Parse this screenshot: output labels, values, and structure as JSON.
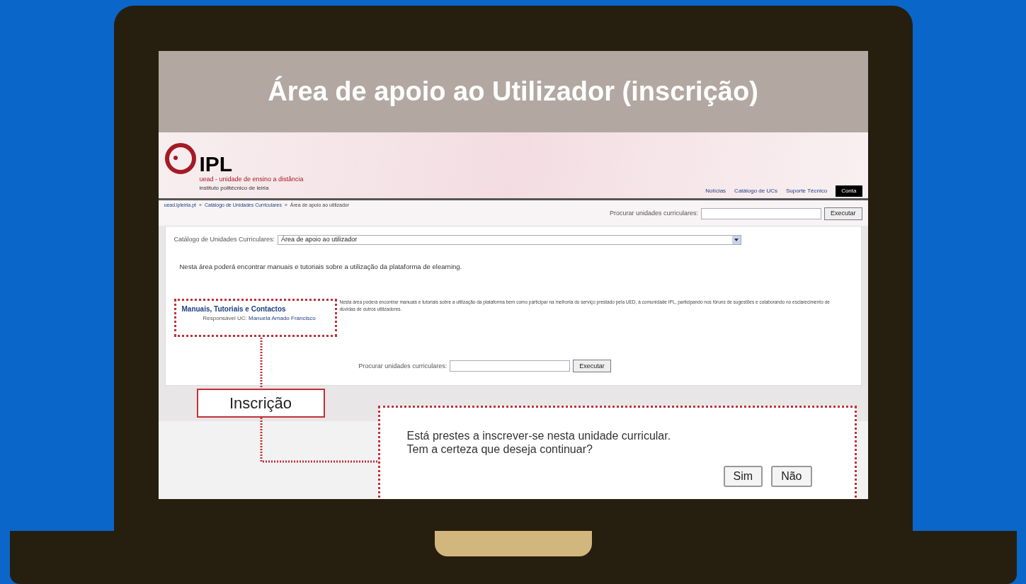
{
  "slide_title": "Área de apoio ao Utilizador (inscrição)",
  "site_header": {
    "logo_text": "IPL",
    "logo_subtitle": "uead - unidade de ensino a distância",
    "logo_caption": "instituto politécnico de leiria",
    "nav": [
      {
        "label": "Notícias",
        "selected": false
      },
      {
        "label": "Catálogo de UCs",
        "selected": false
      },
      {
        "label": "Suporte Técnico",
        "selected": false
      },
      {
        "label": "Conta",
        "selected": true
      }
    ]
  },
  "breadcrumb": {
    "separator": "»",
    "items": [
      "uead.ipleiria.pt",
      "Catálogo de Unidades Curriculares",
      "Área de apoio ao utilizador"
    ]
  },
  "top_search": {
    "label": "Procurar unidades curriculares:",
    "button": "Executar"
  },
  "catalog_select": {
    "label": "Catálogo de Unidades Curriculares:",
    "value": "Área de apoio ao utilizador"
  },
  "intro": "Nesta área poderá encontrar manuais e tutoriais sobre a utilização da plataforma de elearning.",
  "course": {
    "title": "Manuais, Tutoriais e Contactos",
    "responsible_label": "Responsável UC:",
    "responsible_name": "Manuela Amado Francisco",
    "description": "Nesta área poderá encontrar manuais e tutoriais sobre a utilização da plataforma bem como participar na melhoria do serviço prestado pela UED, à comunidade IPL, participando nos fóruns de sugestões e colaborando no esclarecimento de dúvidas de outros utilizadores."
  },
  "bottom_search": {
    "label": "Procurar unidades curriculares:",
    "button": "Executar"
  },
  "callout": "Inscrição",
  "dialog": {
    "lines": [
      "Está prestes a inscrever-se nesta unidade curricular.",
      "Tem a certeza que deseja continuar?"
    ],
    "buttons": [
      "Sim",
      "Não"
    ]
  }
}
